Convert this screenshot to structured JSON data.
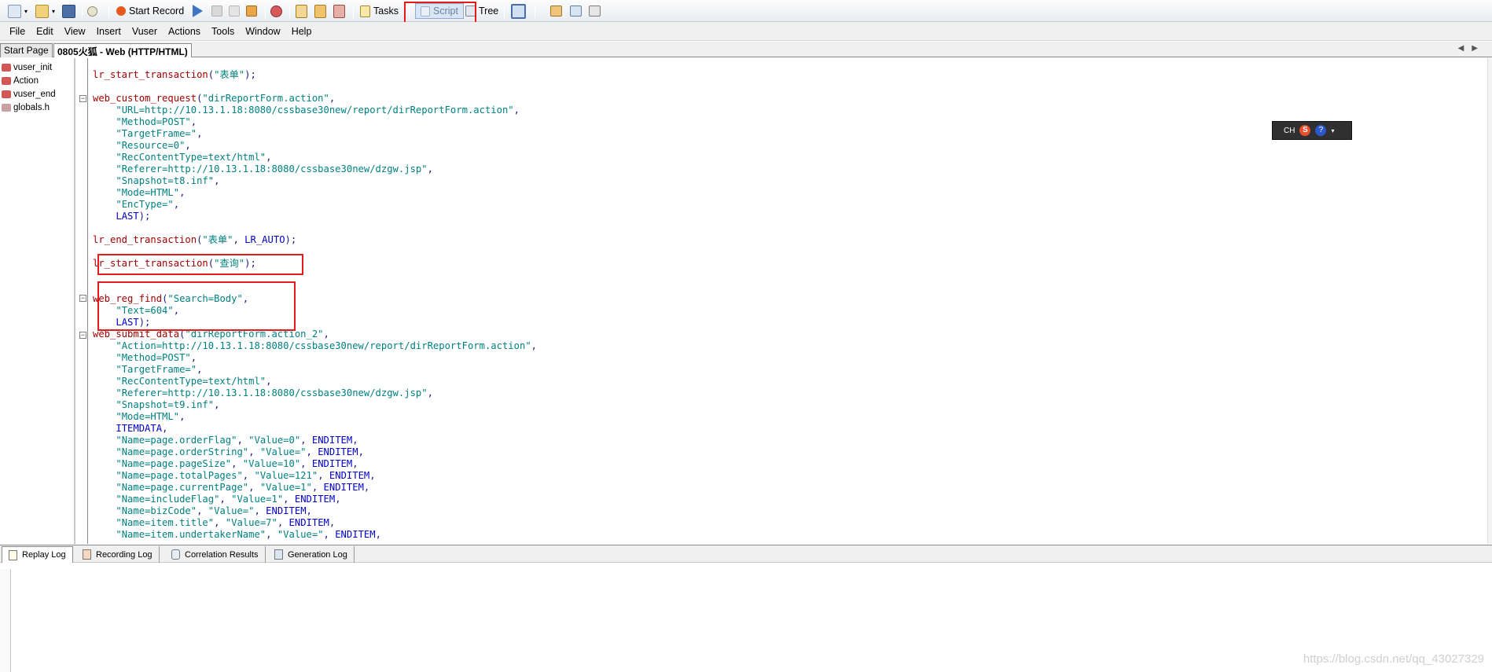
{
  "toolbar": {
    "start_record": "Start Record",
    "tasks": "Tasks",
    "script": "Script",
    "tree": "Tree"
  },
  "menu": [
    "File",
    "Edit",
    "View",
    "Insert",
    "Vuser",
    "Actions",
    "Tools",
    "Window",
    "Help"
  ],
  "tabs": [
    "Start Page",
    "0805火狐 - Web (HTTP/HTML)"
  ],
  "tree_items": [
    "vuser_init",
    "Action",
    "vuser_end",
    "globals.h"
  ],
  "code_lines": [
    "lr_start_transaction(\"表单\");",
    "",
    "web_custom_request(\"dirReportForm.action\",",
    "    \"URL=http://10.13.1.18:8080/cssbase30new/report/dirReportForm.action\",",
    "    \"Method=POST\",",
    "    \"TargetFrame=\",",
    "    \"Resource=0\",",
    "    \"RecContentType=text/html\",",
    "    \"Referer=http://10.13.1.18:8080/cssbase30new/dzgw.jsp\",",
    "    \"Snapshot=t8.inf\",",
    "    \"Mode=HTML\",",
    "    \"EncType=\",",
    "    LAST);",
    "",
    "lr_end_transaction(\"表单\", LR_AUTO);",
    "",
    "lr_start_transaction(\"查询\");",
    "",
    "",
    "web_reg_find(\"Search=Body\",",
    "    \"Text=604\",",
    "    LAST);",
    "web_submit_data(\"dirReportForm.action_2\",",
    "    \"Action=http://10.13.1.18:8080/cssbase30new/report/dirReportForm.action\",",
    "    \"Method=POST\",",
    "    \"TargetFrame=\",",
    "    \"RecContentType=text/html\",",
    "    \"Referer=http://10.13.1.18:8080/cssbase30new/dzgw.jsp\",",
    "    \"Snapshot=t9.inf\",",
    "    \"Mode=HTML\",",
    "    ITEMDATA,",
    "    \"Name=page.orderFlag\", \"Value=0\", ENDITEM,",
    "    \"Name=page.orderString\", \"Value=\", ENDITEM,",
    "    \"Name=page.pageSize\", \"Value=10\", ENDITEM,",
    "    \"Name=page.totalPages\", \"Value=121\", ENDITEM,",
    "    \"Name=page.currentPage\", \"Value=1\", ENDITEM,",
    "    \"Name=includeFlag\", \"Value=1\", ENDITEM,",
    "    \"Name=bizCode\", \"Value=\", ENDITEM,",
    "    \"Name=item.title\", \"Value=7\", ENDITEM,",
    "    \"Name=item.undertakerName\", \"Value=\", ENDITEM,"
  ],
  "ime": {
    "lang": "CH",
    "s": "S",
    "help": "?"
  },
  "log_tabs": [
    "Replay Log",
    "Recording Log",
    "Correlation Results",
    "Generation Log"
  ],
  "watermark": "https://blog.csdn.net/qq_43027329",
  "colors": {
    "highlight": "#e41b1b",
    "function": "#a00000",
    "string": "#008080",
    "keyword": "#0000c8"
  }
}
